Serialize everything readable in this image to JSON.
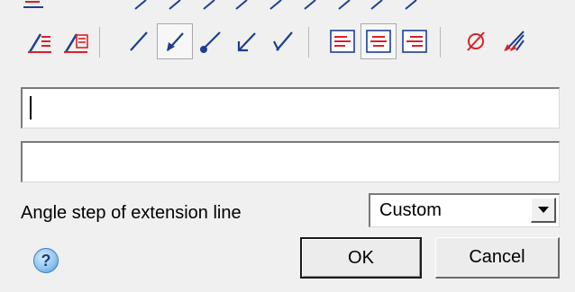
{
  "icons": {
    "dim_text_above": "dimension-text-above-icon",
    "dim_text_boxed": "dimension-text-boxed-icon",
    "line_plain": "line-no-arrow-icon",
    "line_arrow": "line-arrow-icon",
    "line_dot": "line-dot-icon",
    "line_open_arrow": "line-open-arrow-icon",
    "line_tick": "line-tick-icon",
    "align_left": "text-align-left-icon",
    "align_center": "text-align-center-icon",
    "align_right": "text-align-right-icon",
    "diameter": "diameter-symbol-icon",
    "leader_style": "leader-style-icon",
    "help": "help-icon",
    "dropdown": "dropdown-arrow-icon"
  },
  "fields": {
    "text1_value": "",
    "text2_value": ""
  },
  "angle_step": {
    "label": "Angle step of extension line",
    "selected": "Custom"
  },
  "buttons": {
    "help_label": "?",
    "ok_label": "OK",
    "cancel_label": "Cancel"
  },
  "colors": {
    "icon_red": "#d9202a",
    "icon_blue": "#1e3f8f",
    "background": "#f0f0f0"
  }
}
